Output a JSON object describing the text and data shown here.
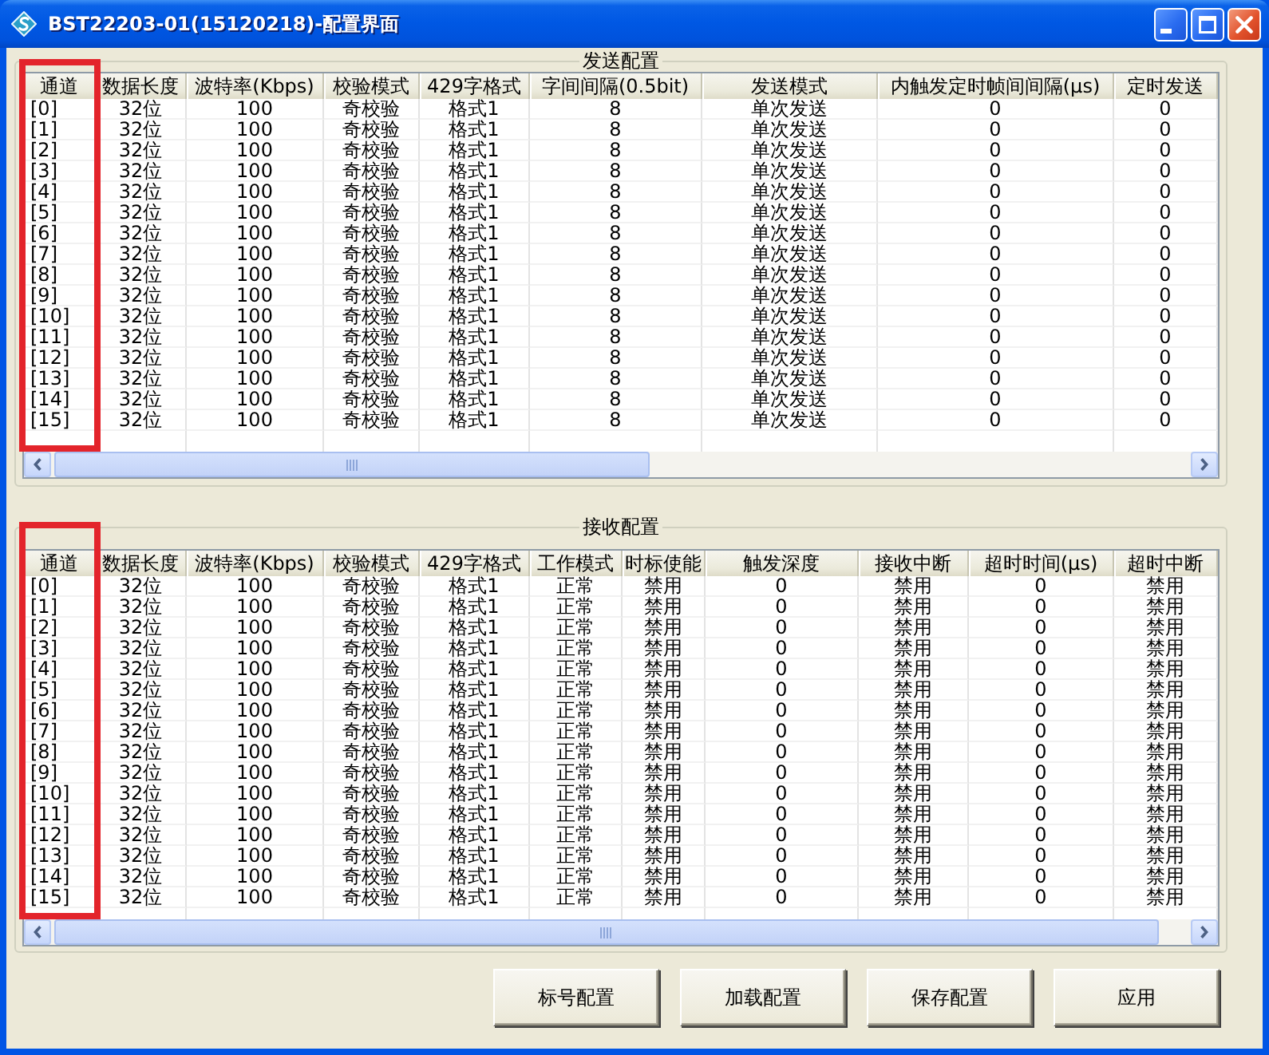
{
  "window": {
    "title": "BST22203-01(15120218)-配置界面"
  },
  "send_config": {
    "title": "发送配置",
    "columns": [
      {
        "label": "通道",
        "highlighted": true
      },
      {
        "label": "数据长度",
        "highlighted": false
      },
      {
        "label": "波特率(Kbps)",
        "highlighted": false
      },
      {
        "label": "校验模式",
        "highlighted": false
      },
      {
        "label": "429字格式",
        "highlighted": false
      },
      {
        "label": "字间间隔(0.5bit)",
        "highlighted": false
      },
      {
        "label": "发送模式",
        "highlighted": false
      },
      {
        "label": "内触发定时帧间间隔(μs)",
        "highlighted": false
      },
      {
        "label": "定时发送",
        "highlighted": false
      }
    ],
    "rows": [
      [
        "[0]",
        "32位",
        "100",
        "奇校验",
        "格式1",
        "8",
        "单次发送",
        "0",
        "0"
      ],
      [
        "[1]",
        "32位",
        "100",
        "奇校验",
        "格式1",
        "8",
        "单次发送",
        "0",
        "0"
      ],
      [
        "[2]",
        "32位",
        "100",
        "奇校验",
        "格式1",
        "8",
        "单次发送",
        "0",
        "0"
      ],
      [
        "[3]",
        "32位",
        "100",
        "奇校验",
        "格式1",
        "8",
        "单次发送",
        "0",
        "0"
      ],
      [
        "[4]",
        "32位",
        "100",
        "奇校验",
        "格式1",
        "8",
        "单次发送",
        "0",
        "0"
      ],
      [
        "[5]",
        "32位",
        "100",
        "奇校验",
        "格式1",
        "8",
        "单次发送",
        "0",
        "0"
      ],
      [
        "[6]",
        "32位",
        "100",
        "奇校验",
        "格式1",
        "8",
        "单次发送",
        "0",
        "0"
      ],
      [
        "[7]",
        "32位",
        "100",
        "奇校验",
        "格式1",
        "8",
        "单次发送",
        "0",
        "0"
      ],
      [
        "[8]",
        "32位",
        "100",
        "奇校验",
        "格式1",
        "8",
        "单次发送",
        "0",
        "0"
      ],
      [
        "[9]",
        "32位",
        "100",
        "奇校验",
        "格式1",
        "8",
        "单次发送",
        "0",
        "0"
      ],
      [
        "[10]",
        "32位",
        "100",
        "奇校验",
        "格式1",
        "8",
        "单次发送",
        "0",
        "0"
      ],
      [
        "[11]",
        "32位",
        "100",
        "奇校验",
        "格式1",
        "8",
        "单次发送",
        "0",
        "0"
      ],
      [
        "[12]",
        "32位",
        "100",
        "奇校验",
        "格式1",
        "8",
        "单次发送",
        "0",
        "0"
      ],
      [
        "[13]",
        "32位",
        "100",
        "奇校验",
        "格式1",
        "8",
        "单次发送",
        "0",
        "0"
      ],
      [
        "[14]",
        "32位",
        "100",
        "奇校验",
        "格式1",
        "8",
        "单次发送",
        "0",
        "0"
      ],
      [
        "[15]",
        "32位",
        "100",
        "奇校验",
        "格式1",
        "8",
        "单次发送",
        "0",
        "0"
      ]
    ]
  },
  "receive_config": {
    "title": "接收配置",
    "columns": [
      {
        "label": "通道",
        "highlighted": true
      },
      {
        "label": "数据长度",
        "highlighted": false
      },
      {
        "label": "波特率(Kbps)",
        "highlighted": false
      },
      {
        "label": "校验模式",
        "highlighted": false
      },
      {
        "label": "429字格式",
        "highlighted": false
      },
      {
        "label": "工作模式",
        "highlighted": false
      },
      {
        "label": "时标使能",
        "highlighted": false
      },
      {
        "label": "触发深度",
        "highlighted": false
      },
      {
        "label": "接收中断",
        "highlighted": false
      },
      {
        "label": "超时时间(μs)",
        "highlighted": false
      },
      {
        "label": "超时中断",
        "highlighted": false
      }
    ],
    "rows": [
      [
        "[0]",
        "32位",
        "100",
        "奇校验",
        "格式1",
        "正常",
        "禁用",
        "0",
        "禁用",
        "0",
        "禁用"
      ],
      [
        "[1]",
        "32位",
        "100",
        "奇校验",
        "格式1",
        "正常",
        "禁用",
        "0",
        "禁用",
        "0",
        "禁用"
      ],
      [
        "[2]",
        "32位",
        "100",
        "奇校验",
        "格式1",
        "正常",
        "禁用",
        "0",
        "禁用",
        "0",
        "禁用"
      ],
      [
        "[3]",
        "32位",
        "100",
        "奇校验",
        "格式1",
        "正常",
        "禁用",
        "0",
        "禁用",
        "0",
        "禁用"
      ],
      [
        "[4]",
        "32位",
        "100",
        "奇校验",
        "格式1",
        "正常",
        "禁用",
        "0",
        "禁用",
        "0",
        "禁用"
      ],
      [
        "[5]",
        "32位",
        "100",
        "奇校验",
        "格式1",
        "正常",
        "禁用",
        "0",
        "禁用",
        "0",
        "禁用"
      ],
      [
        "[6]",
        "32位",
        "100",
        "奇校验",
        "格式1",
        "正常",
        "禁用",
        "0",
        "禁用",
        "0",
        "禁用"
      ],
      [
        "[7]",
        "32位",
        "100",
        "奇校验",
        "格式1",
        "正常",
        "禁用",
        "0",
        "禁用",
        "0",
        "禁用"
      ],
      [
        "[8]",
        "32位",
        "100",
        "奇校验",
        "格式1",
        "正常",
        "禁用",
        "0",
        "禁用",
        "0",
        "禁用"
      ],
      [
        "[9]",
        "32位",
        "100",
        "奇校验",
        "格式1",
        "正常",
        "禁用",
        "0",
        "禁用",
        "0",
        "禁用"
      ],
      [
        "[10]",
        "32位",
        "100",
        "奇校验",
        "格式1",
        "正常",
        "禁用",
        "0",
        "禁用",
        "0",
        "禁用"
      ],
      [
        "[11]",
        "32位",
        "100",
        "奇校验",
        "格式1",
        "正常",
        "禁用",
        "0",
        "禁用",
        "0",
        "禁用"
      ],
      [
        "[12]",
        "32位",
        "100",
        "奇校验",
        "格式1",
        "正常",
        "禁用",
        "0",
        "禁用",
        "0",
        "禁用"
      ],
      [
        "[13]",
        "32位",
        "100",
        "奇校验",
        "格式1",
        "正常",
        "禁用",
        "0",
        "禁用",
        "0",
        "禁用"
      ],
      [
        "[14]",
        "32位",
        "100",
        "奇校验",
        "格式1",
        "正常",
        "禁用",
        "0",
        "禁用",
        "0",
        "禁用"
      ],
      [
        "[15]",
        "32位",
        "100",
        "奇校验",
        "格式1",
        "正常",
        "禁用",
        "0",
        "禁用",
        "0",
        "禁用"
      ]
    ]
  },
  "buttons": [
    {
      "label": "标号配置"
    },
    {
      "label": "加载配置"
    },
    {
      "label": "保存配置"
    },
    {
      "label": "应用"
    }
  ]
}
